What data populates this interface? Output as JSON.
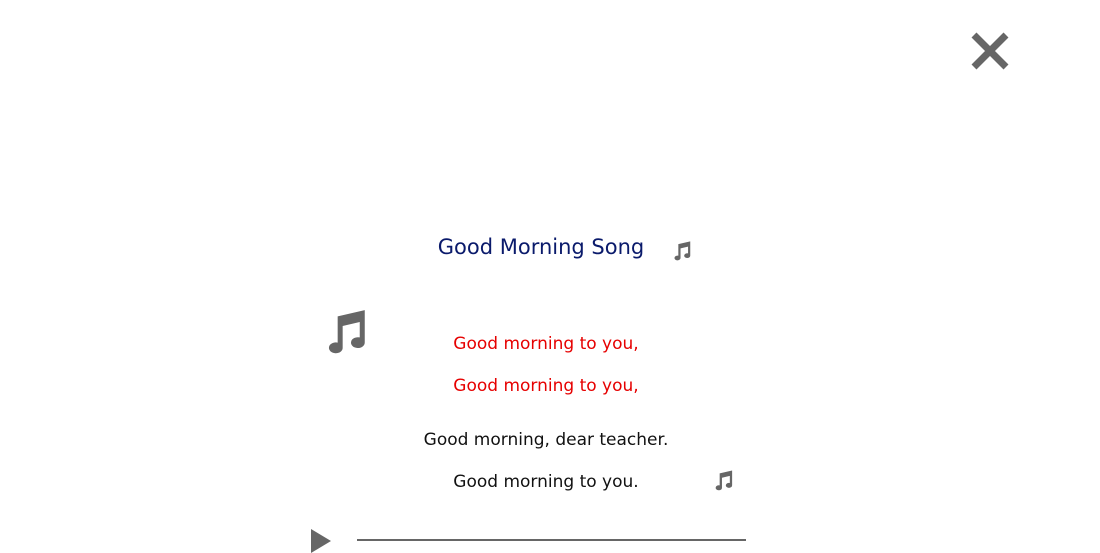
{
  "header": {
    "close_icon": "close-icon"
  },
  "song": {
    "title": "Good Morning Song",
    "title_icon": "music-note-icon"
  },
  "lyrics": [
    {
      "text": "Good morning to you,",
      "state": "highlighted"
    },
    {
      "text": "Good morning to you,",
      "state": "highlighted"
    },
    {
      "text": "Good morning, dear teacher.",
      "state": "normal"
    },
    {
      "text": "Good morning to you.",
      "state": "normal"
    }
  ],
  "player": {
    "play_icon": "play-icon",
    "progress": 0
  },
  "colors": {
    "title": "#0a1a6b",
    "highlight": "#e60000",
    "normal_text": "#111111",
    "icon": "#666666"
  }
}
